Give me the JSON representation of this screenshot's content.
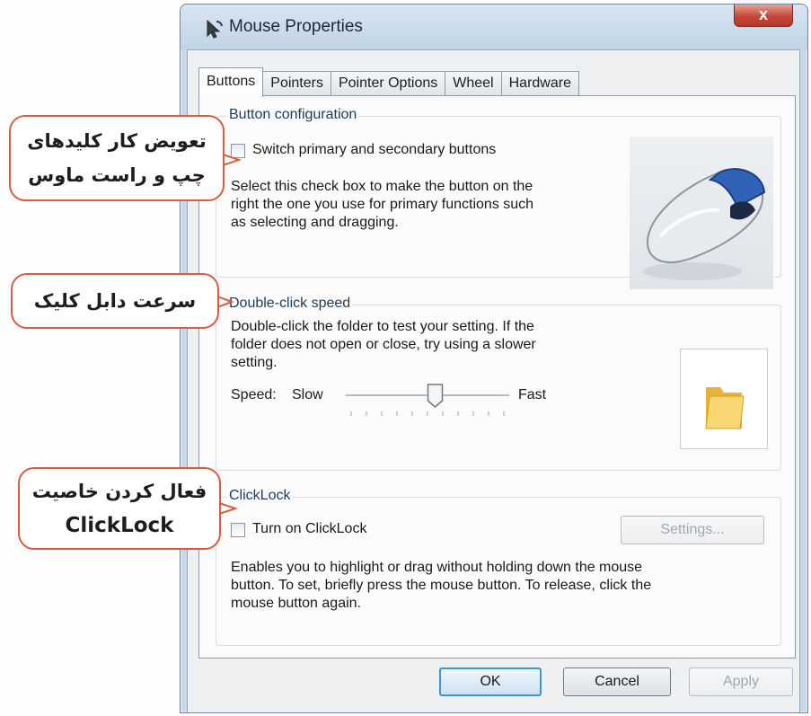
{
  "window": {
    "title": "Mouse Properties",
    "close_label": "x"
  },
  "tabs": [
    {
      "label": "Buttons",
      "active": true
    },
    {
      "label": "Pointers",
      "active": false
    },
    {
      "label": "Pointer Options",
      "active": false
    },
    {
      "label": "Wheel",
      "active": false
    },
    {
      "label": "Hardware",
      "active": false
    }
  ],
  "button_configuration": {
    "title": "Button configuration",
    "checkbox_label": "Switch primary and secondary buttons",
    "checked": false,
    "description_lines": [
      "Select this check box to make the button on the",
      "right the one you use for primary functions such",
      "as selecting and dragging."
    ]
  },
  "double_click": {
    "title": "Double-click speed",
    "description_lines": [
      "Double-click the folder to test your setting. If the",
      "folder does not open or close, try using a slower",
      "setting."
    ],
    "speed_label": "Speed:",
    "slow_label": "Slow",
    "fast_label": "Fast",
    "speed_value": 0.55
  },
  "clicklock": {
    "title": "ClickLock",
    "checkbox_label": "Turn on ClickLock",
    "checked": false,
    "settings_label": "Settings...",
    "description_lines": [
      "Enables you to highlight or drag without holding down the mouse",
      "button. To set, briefly press the mouse button. To release, click the",
      "mouse button again."
    ]
  },
  "footer": {
    "ok_label": "OK",
    "cancel_label": "Cancel",
    "apply_label": "Apply"
  },
  "callouts": [
    {
      "lines": [
        "تعویض کار کلیدهای",
        "چپ و راست ماوس"
      ]
    },
    {
      "lines": [
        "سرعت دابل کلیک"
      ]
    },
    {
      "lines": [
        "فعال کردن خاصیت",
        "ClickLock"
      ]
    }
  ],
  "colors": {
    "callout_border": "#d65d3e",
    "default_button_border": "#3d95d6",
    "close_button": "#c5483a"
  }
}
